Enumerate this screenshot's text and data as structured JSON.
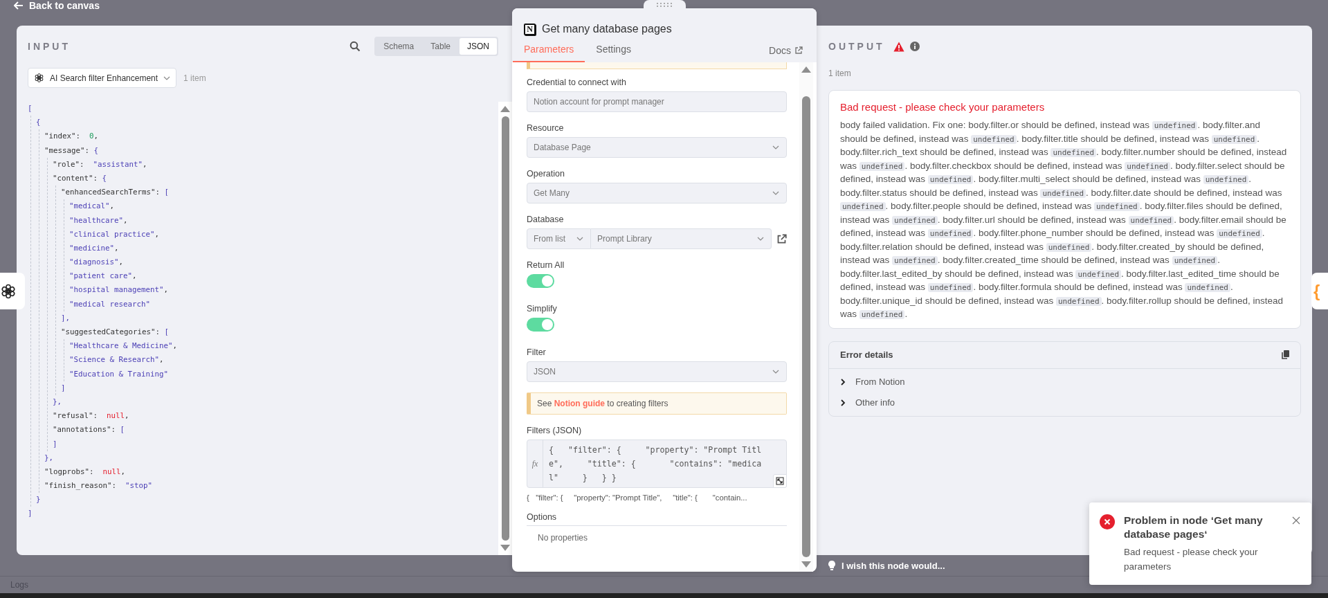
{
  "top_bar": {
    "back_label": "Back to canvas"
  },
  "input": {
    "title": "INPUT",
    "view_tabs": [
      {
        "label": "Schema",
        "selected": false
      },
      {
        "label": "Table",
        "selected": false
      },
      {
        "label": "JSON",
        "selected": true
      }
    ],
    "source_node": "AI Search filter Enhancement",
    "item_count": "1 item",
    "json": {
      "open": "[",
      "close": "]",
      "children": [
        {
          "open": "{",
          "close": "}",
          "children": [
            {
              "key": "\"index\":",
              "value": "0",
              "kind": "number",
              "trail": ","
            },
            {
              "key": "\"message\":",
              "open": "{",
              "close": "},",
              "children": [
                {
                  "key": "\"role\":",
                  "value": "\"assistant\"",
                  "kind": "string",
                  "trail": ","
                },
                {
                  "key": "\"content\":",
                  "open": "{",
                  "close": "},",
                  "children": [
                    {
                      "key": "\"enhancedSearchTerms\":",
                      "open": "[",
                      "close": "],",
                      "children": [
                        {
                          "value": "\"medical\"",
                          "kind": "string",
                          "trail": ","
                        },
                        {
                          "value": "\"healthcare\"",
                          "kind": "string",
                          "trail": ","
                        },
                        {
                          "value": "\"clinical practice\"",
                          "kind": "string",
                          "trail": ","
                        },
                        {
                          "value": "\"medicine\"",
                          "kind": "string",
                          "trail": ","
                        },
                        {
                          "value": "\"diagnosis\"",
                          "kind": "string",
                          "trail": ","
                        },
                        {
                          "value": "\"patient care\"",
                          "kind": "string",
                          "trail": ","
                        },
                        {
                          "value": "\"hospital management\"",
                          "kind": "string",
                          "trail": ","
                        },
                        {
                          "value": "\"medical research\"",
                          "kind": "string"
                        }
                      ]
                    },
                    {
                      "key": "\"suggestedCategories\":",
                      "open": "[",
                      "close": "]",
                      "children": [
                        {
                          "value": "\"Healthcare & Medicine\"",
                          "kind": "string",
                          "trail": ","
                        },
                        {
                          "value": "\"Science & Research\"",
                          "kind": "string",
                          "trail": ","
                        },
                        {
                          "value": "\"Education & Training\"",
                          "kind": "string"
                        }
                      ]
                    }
                  ]
                },
                {
                  "key": "\"refusal\":",
                  "value": "null",
                  "kind": "null",
                  "trail": ","
                },
                {
                  "key": "\"annotations\":",
                  "open": "[",
                  "close": "]"
                }
              ]
            },
            {
              "key": "\"logprobs\":",
              "value": "null",
              "kind": "null",
              "trail": ","
            },
            {
              "key": "\"finish_reason\":",
              "value": "\"stop\"",
              "kind": "string"
            }
          ]
        }
      ]
    }
  },
  "node": {
    "logo_glyph": "N",
    "title": "Get many database pages",
    "tabs": [
      {
        "label": "Parameters",
        "selected": true
      },
      {
        "label": "Settings",
        "selected": false
      }
    ],
    "docs_label": "Docs",
    "fields": [
      {
        "kind": "sliver"
      },
      {
        "kind": "input",
        "label": "Credential to connect with",
        "value": "Notion account for prompt manager"
      },
      {
        "kind": "select",
        "label": "Resource",
        "value": "Database Page"
      },
      {
        "kind": "select",
        "label": "Operation",
        "value": "Get Many"
      },
      {
        "kind": "locator",
        "label": "Database",
        "mode": "From list",
        "value": "Prompt Library"
      },
      {
        "kind": "toggle",
        "label": "Return All",
        "on": true
      },
      {
        "kind": "toggle",
        "label": "Simplify",
        "on": true
      },
      {
        "kind": "select",
        "label": "Filter",
        "value": "JSON"
      },
      {
        "kind": "notice",
        "before": "See ",
        "link": "Notion guide",
        "after": " to creating filters"
      },
      {
        "kind": "code",
        "label": "Filters (JSON)",
        "gutter": "fx",
        "value": "{   \"filter\": {     \"property\": \"Prompt Title\",     \"title\": {       \"contains\": \"medical\"     }   } }",
        "preview": "{   \"filter\": {     \"property\": \"Prompt Title\",     \"title\": {       \"contain..."
      }
    ],
    "options": {
      "title": "Options",
      "empty_text": "No properties"
    }
  },
  "output": {
    "title": "OUTPUT",
    "item_count": "1 item",
    "error_title": "Bad request - please check your parameters",
    "message_parts": [
      {
        "text": "body failed validation. Fix one: body.filter.or should be defined, instead was ",
        "code": "undefined"
      },
      {
        "text": ". body.filter.and should be defined, instead was ",
        "code": "undefined"
      },
      {
        "text": ". body.filter.title should be defined, instead was ",
        "code": "undefined"
      },
      {
        "text": ". body.filter.rich_text should be defined, instead was ",
        "code": "undefined"
      },
      {
        "text": ". body.filter.number should be defined, instead was ",
        "code": "undefined"
      },
      {
        "text": ". body.filter.checkbox should be defined, instead was ",
        "code": "undefined"
      },
      {
        "text": ". body.filter.select should be defined, instead was ",
        "code": "undefined"
      },
      {
        "text": ". body.filter.multi_select should be defined, instead was ",
        "code": "undefined"
      },
      {
        "text": ". body.filter.status should be defined, instead was ",
        "code": "undefined"
      },
      {
        "text": ". body.filter.date should be defined, instead was ",
        "code": "undefined"
      },
      {
        "text": ". body.filter.people should be defined, instead was ",
        "code": "undefined"
      },
      {
        "text": ". body.filter.files should be defined, instead was ",
        "code": "undefined"
      },
      {
        "text": ". body.filter.url should be defined, instead was ",
        "code": "undefined"
      },
      {
        "text": ". body.filter.email should be defined, instead was ",
        "code": "undefined"
      },
      {
        "text": ". body.filter.phone_number should be defined, instead was ",
        "code": "undefined"
      },
      {
        "text": ". body.filter.relation should be defined, instead was ",
        "code": "undefined"
      },
      {
        "text": ". body.filter.created_by should be defined, instead was ",
        "code": "undefined"
      },
      {
        "text": ". body.filter.created_time should be defined, instead was ",
        "code": "undefined"
      },
      {
        "text": ". body.filter.last_edited_by should be defined, instead was ",
        "code": "undefined"
      },
      {
        "text": ". body.filter.last_edited_time should be defined, instead was ",
        "code": "undefined"
      },
      {
        "text": ". body.filter.formula should be defined, instead was ",
        "code": "undefined"
      },
      {
        "text": ". body.filter.unique_id should be defined, instead was ",
        "code": "undefined"
      },
      {
        "text": ". body.filter.rollup should be defined, instead was ",
        "code": "undefined"
      },
      {
        "text": "."
      }
    ],
    "details": {
      "title": "Error details",
      "rows": [
        {
          "label": "From Notion",
          "expanded": false
        },
        {
          "label": "Other info",
          "expanded": false
        }
      ]
    }
  },
  "feedback": {
    "label": "I wish this node would..."
  },
  "logs": {
    "label": "Logs"
  },
  "right_tab": {
    "glyph": "{"
  },
  "toast": {
    "title": "Problem in node ‘Get many database pages‘",
    "message": "Bad request - please check your parameters"
  }
}
